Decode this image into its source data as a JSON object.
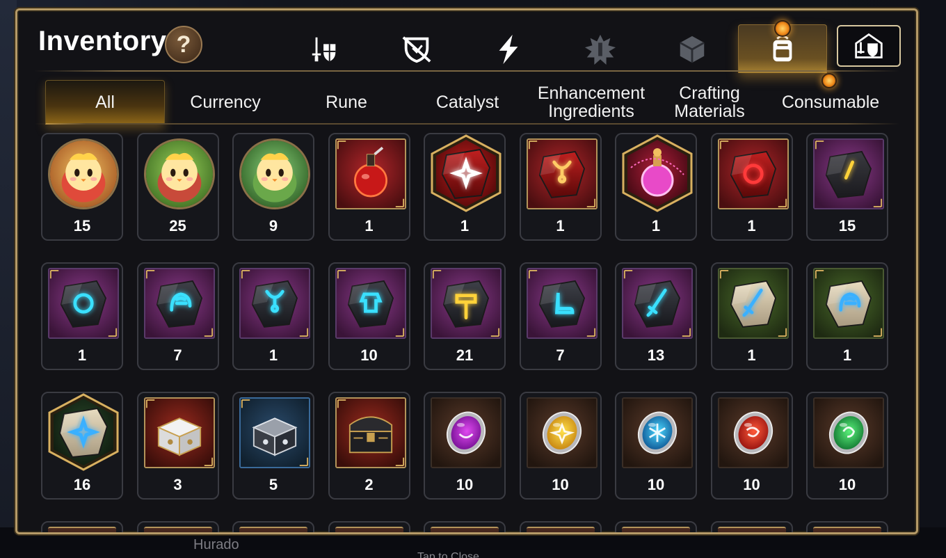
{
  "backdrop": {
    "footer_name": "Hurado",
    "close_hint": "Tap to Close"
  },
  "header": {
    "title": "Inventory",
    "help_label": "?",
    "category_tabs": [
      {
        "icon": "sword-shield-icon",
        "active": false
      },
      {
        "icon": "broken-shield-icon",
        "active": false
      },
      {
        "icon": "lightning-icon",
        "active": false
      },
      {
        "icon": "burst-emblem-icon",
        "active": false
      },
      {
        "icon": "cube-icon",
        "active": false
      },
      {
        "icon": "backpack-icon",
        "active": true
      }
    ],
    "special_button_icon": "castle-shield-icon"
  },
  "subtabs": [
    {
      "label": "All",
      "active": true
    },
    {
      "label": "Currency",
      "active": false
    },
    {
      "label": "Rune",
      "active": false
    },
    {
      "label": "Catalyst",
      "active": false
    },
    {
      "label": "Enhancement\nIngredients",
      "active": false
    },
    {
      "label": "Crafting\nMaterials",
      "active": false
    },
    {
      "label": "Consumable",
      "active": false
    }
  ],
  "items": [
    {
      "count": "15",
      "kind": "chick-portrait-red",
      "frame": "circle"
    },
    {
      "count": "25",
      "kind": "chick-portrait-green",
      "frame": "circle"
    },
    {
      "count": "9",
      "kind": "chick-portrait-leaf",
      "frame": "circle"
    },
    {
      "count": "1",
      "kind": "red-potion",
      "frame": "gold"
    },
    {
      "count": "1",
      "kind": "red-stone-star",
      "frame": "hex"
    },
    {
      "count": "1",
      "kind": "red-stone-necklace",
      "frame": "gold"
    },
    {
      "count": "1",
      "kind": "pink-potion",
      "frame": "hex"
    },
    {
      "count": "1",
      "kind": "red-stone-ring",
      "frame": "gold"
    },
    {
      "count": "15",
      "kind": "purple-stone-gold",
      "frame": "purple"
    },
    {
      "count": "1",
      "kind": "rune-ring",
      "frame": "purple"
    },
    {
      "count": "7",
      "kind": "rune-helm",
      "frame": "purple"
    },
    {
      "count": "1",
      "kind": "rune-necklace",
      "frame": "purple"
    },
    {
      "count": "10",
      "kind": "rune-armor",
      "frame": "purple"
    },
    {
      "count": "21",
      "kind": "rune-hammer",
      "frame": "purple"
    },
    {
      "count": "7",
      "kind": "rune-boot",
      "frame": "purple"
    },
    {
      "count": "13",
      "kind": "rune-sword",
      "frame": "purple"
    },
    {
      "count": "1",
      "kind": "pale-sword",
      "frame": "green"
    },
    {
      "count": "1",
      "kind": "pale-helm",
      "frame": "green"
    },
    {
      "count": "16",
      "kind": "pale-star",
      "frame": "hex"
    },
    {
      "count": "3",
      "kind": "white-chest",
      "frame": "gold"
    },
    {
      "count": "5",
      "kind": "silver-chest",
      "frame": "blue"
    },
    {
      "count": "2",
      "kind": "dark-chest",
      "frame": "gold"
    },
    {
      "count": "10",
      "kind": "orb-purple",
      "frame": "brown"
    },
    {
      "count": "10",
      "kind": "orb-gold",
      "frame": "brown"
    },
    {
      "count": "10",
      "kind": "orb-blue",
      "frame": "brown"
    },
    {
      "count": "10",
      "kind": "orb-red",
      "frame": "brown"
    },
    {
      "count": "10",
      "kind": "orb-green",
      "frame": "brown"
    }
  ],
  "colors": {
    "gold_accent": "#d8a84a",
    "panel_border": "#b59a67",
    "cell_border": "#3a3b42",
    "notification": "#f08a1a"
  }
}
